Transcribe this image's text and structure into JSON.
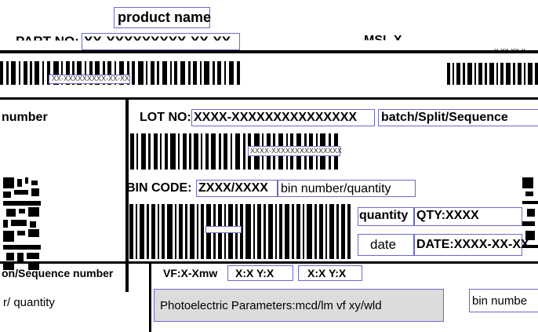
{
  "label": {
    "product_name": "product name",
    "part_no_prefix": "PART NO:",
    "part_no_value": "XX-XXXXXXXXX-XX-XX",
    "msl": "MSL X",
    "part_no_small": "XX-XXXXXXXXX-XX-XX",
    "number": "number",
    "lot_no_prefix": "LOT NO:",
    "lot_no_value": "XXXX-XXXXXXXXXXXXXXX",
    "batch_split": "batch/Split/Sequence",
    "lot_barcode_text": "XXXX-XXXXXXXXXXXXXXX",
    "bin_code_prefix": "BIN CODE:",
    "bin_code_value": "ZXXX/XXXX",
    "bin_number_quantity": "bin number/quantity",
    "quantity_label": "quantity",
    "qty_value": "QTY:XXXX",
    "date_label": "date",
    "date_value": "DATE:XXXX-XX-XX",
    "split_sequence_left": "on/Sequence number",
    "vf_text": "VF:X-Xmw",
    "xy_text": "X:X Y:X",
    "xy_text2": "X:X Y:X",
    "quantity_left": "r/ quantity",
    "photoelectric": "Photoelectric Parameters:mcd/lm vf  xy/wld",
    "bin_number_right": "bin numbe",
    "right_top_text": "X-XX-XX-X"
  },
  "colors": {
    "box_border": "#6a6acc",
    "shade": "#dcdcdc"
  }
}
